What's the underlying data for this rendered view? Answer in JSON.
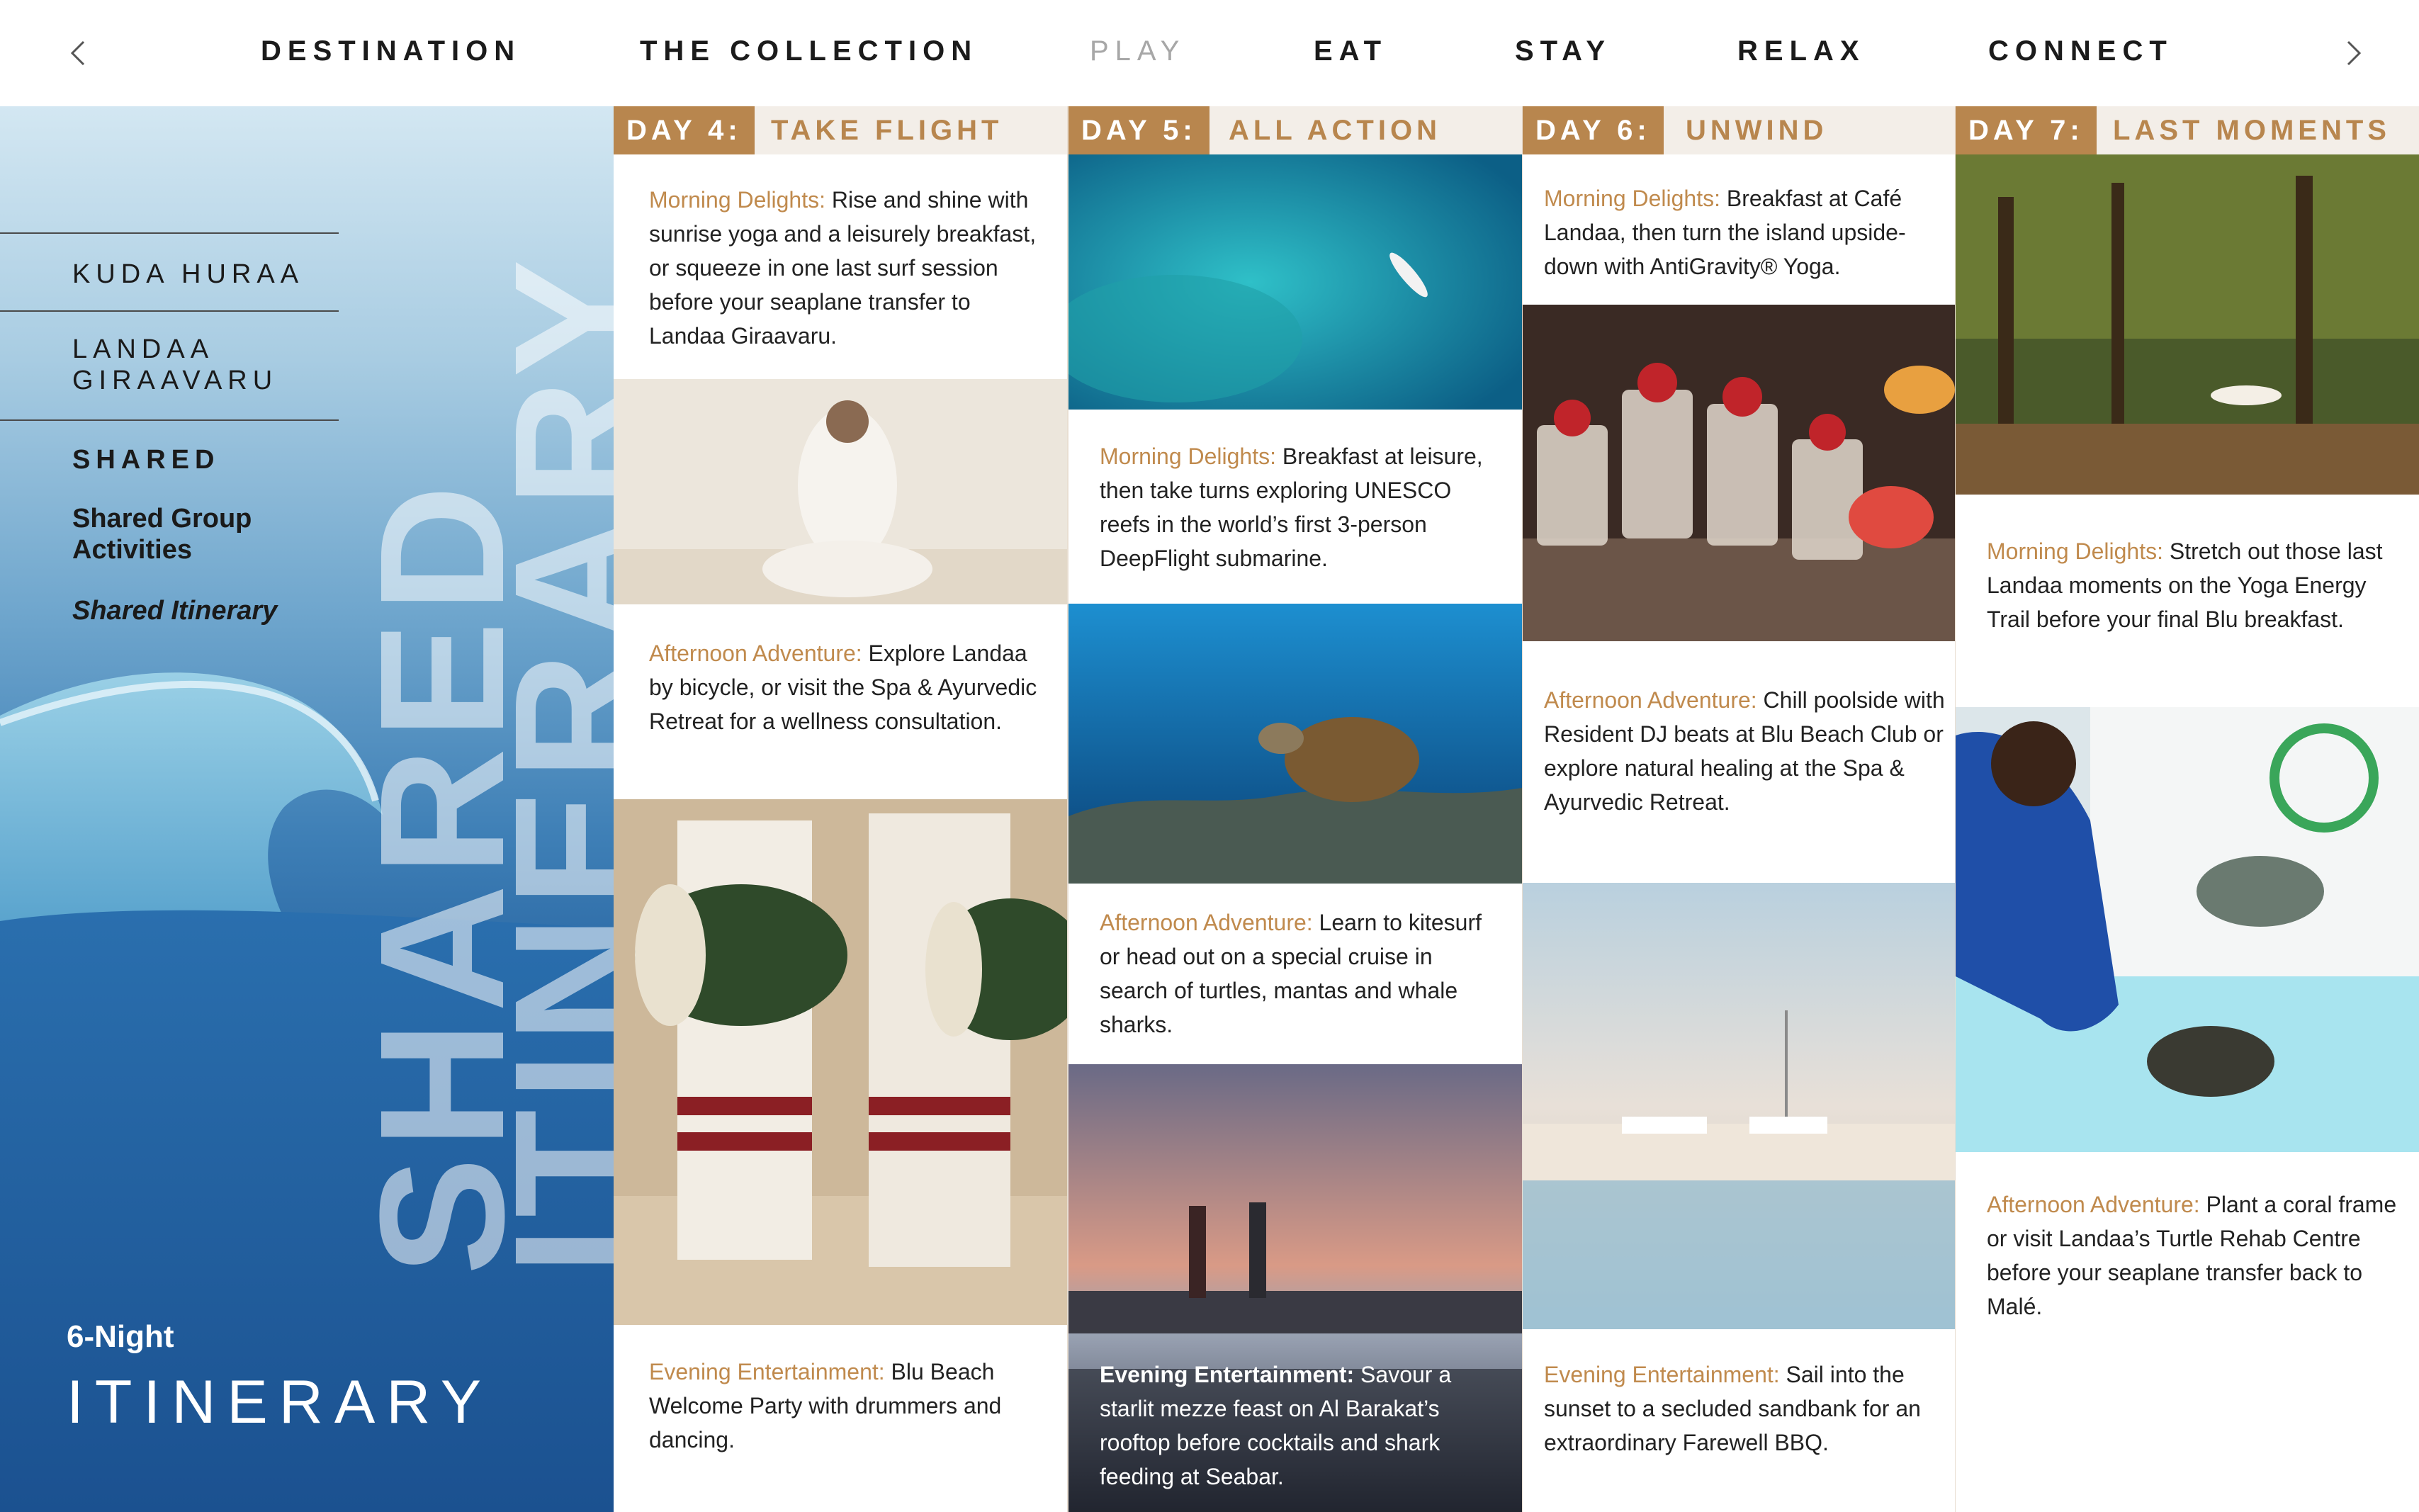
{
  "nav": {
    "prev_icon": "chevron-left-icon",
    "next_icon": "chevron-right-icon",
    "items": [
      "DESTINATION",
      "THE COLLECTION",
      "PLAY",
      "EAT",
      "STAY",
      "RELAX",
      "CONNECT"
    ],
    "active": "PLAY"
  },
  "sidebar": {
    "resort_1": "KUDA HURAA",
    "resort_2_line1": "LANDAA",
    "resort_2_line2": "GIRAAVARU",
    "section": "SHARED",
    "sub_1_line1": "Shared Group",
    "sub_1_line2": "Activities",
    "sub_2": "Shared Itinerary"
  },
  "hero": {
    "watermark_1": "SHARED",
    "watermark_2": "ITINERARY",
    "eyebrow": "6-Night",
    "title": "ITINERARY"
  },
  "days": [
    {
      "tag": "DAY 4:",
      "title": "TAKE FLIGHT",
      "morning_label": "Morning Delights:",
      "morning_text": "Rise and shine with sunrise yoga and a leisurely breakfast, or squeeze in one last surf session before your seaplane transfer to Landaa Giraavaru.",
      "afternoon_label": "Afternoon Adventure:",
      "afternoon_text": "Explore Landaa by bicycle, or visit the Spa & Ayurvedic Retreat for a wellness consultation.",
      "evening_label": "Evening Entertainment:",
      "evening_text": "Blu Beach Welcome Party with drummers and dancing."
    },
    {
      "tag": "DAY 5:",
      "title": "ALL ACTION",
      "morning_label": "Morning Delights:",
      "morning_text": "Breakfast at leisure, then take turns exploring UNESCO reefs in the world’s first 3-person DeepFlight submarine.",
      "afternoon_label": "Afternoon Adventure:",
      "afternoon_text": "Learn to kitesurf or head out on a special cruise in search of turtles, mantas and whale sharks.",
      "evening_label": "Evening Entertainment:",
      "evening_text": "Savour a starlit mezze feast on Al Barakat’s rooftop before cocktails and shark feeding at Seabar."
    },
    {
      "tag": "DAY 6:",
      "title": "UNWIND",
      "morning_label": "Morning Delights:",
      "morning_text": "Breakfast at Café Landaa, then turn the island upside-down with AntiGravity® Yoga.",
      "afternoon_label": "Afternoon Adventure:",
      "afternoon_text": "Chill poolside with Resident DJ beats at Blu Beach Club or explore natural healing at the Spa & Ayurvedic Retreat.",
      "evening_label": "Evening Entertainment:",
      "evening_text": "Sail into the sunset to a secluded sandbank for an extraordinary Farewell BBQ."
    },
    {
      "tag": "DAY 7:",
      "title": "LAST MOMENTS",
      "morning_label": "Morning Delights:",
      "morning_text": "Stretch out those last Landaa moments on the Yoga Energy Trail before your final Blu breakfast.",
      "afternoon_label": "Afternoon Adventure:",
      "afternoon_text": "Plant a coral frame or visit Landaa’s Turtle Rehab Centre before your seaplane transfer back to Malé."
    }
  ],
  "colors": {
    "accent": "#b8864e",
    "label": "#c08a4d",
    "header_bg": "#f3eee8",
    "nav_dim": "#a7a7a7"
  }
}
